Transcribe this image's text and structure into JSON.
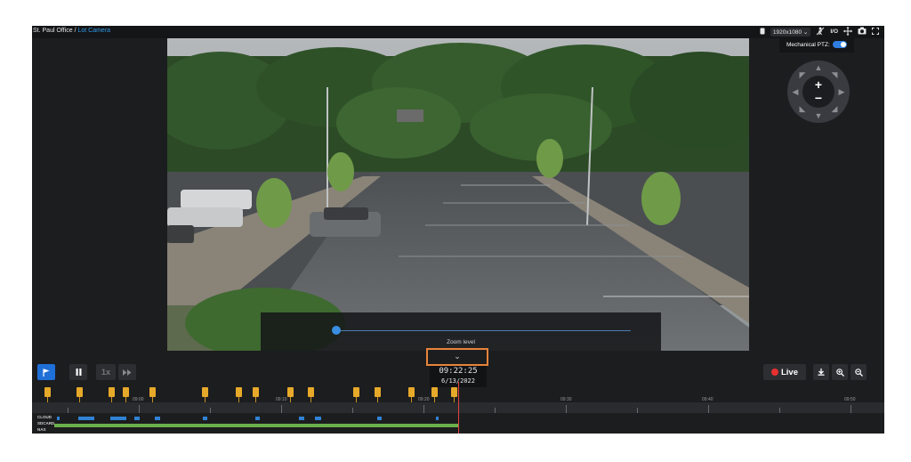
{
  "breadcrumb": {
    "location": "St. Paul Office",
    "separator": " / ",
    "camera": "Lot Camera"
  },
  "toolbar": {
    "resolution": "1920x1080",
    "items": [
      "device-icon",
      "no-motion-icon",
      "io-icon",
      "ptz-move-icon",
      "camera-snapshot-icon",
      "fullscreen-icon"
    ],
    "io_label": "I/O"
  },
  "ptz": {
    "label": "Mechanical PTZ:",
    "enabled": true,
    "zoom_in": "+",
    "zoom_out": "−"
  },
  "zoom": {
    "label": "Zoom level",
    "chevron": "⌄"
  },
  "playback": {
    "flag_icon": "flag-icon",
    "pause_icon": "pause-icon",
    "speed": "1x",
    "ff_icon": "fast-forward-icon"
  },
  "timestamp": {
    "time": "09:22:25",
    "date": "6/13/2022"
  },
  "live": {
    "label": "Live"
  },
  "right_controls": [
    "download-icon",
    "zoom-in-icon",
    "zoom-out-icon"
  ],
  "timeline": {
    "ticks": [
      "09:00",
      "09:10",
      "09:20",
      "09:30",
      "09:40",
      "09:50"
    ],
    "tracks": [
      "CLOUD",
      "SDCARD",
      "NAS"
    ]
  }
}
